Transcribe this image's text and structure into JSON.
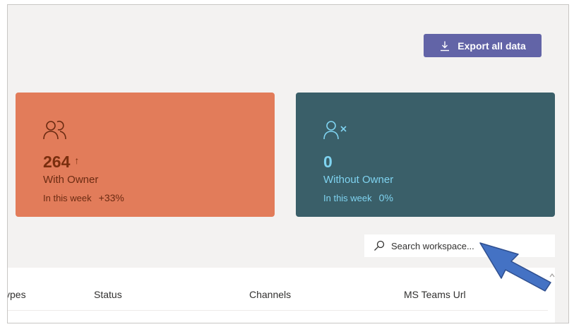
{
  "toolbar": {
    "export_label": "Export all data"
  },
  "cards": {
    "with_owner": {
      "icon": "people-icon",
      "count": "264",
      "trend_glyph": "↑",
      "label": "With Owner",
      "period": "In this week",
      "change": "+33%",
      "color": "#e27c5a"
    },
    "without_owner": {
      "icon": "person-remove-icon",
      "count": "0",
      "label": "Without Owner",
      "period": "In this week",
      "change": "0%",
      "color": "#3a5f69"
    }
  },
  "search": {
    "placeholder": "Search workspace..."
  },
  "table": {
    "columns": [
      "ypes",
      "Status",
      "Channels",
      "MS Teams Url"
    ]
  },
  "accent_color": "#6264a7",
  "annotation": {
    "icon": "blue-arrow-pointer-icon",
    "color": "#4472c4"
  }
}
